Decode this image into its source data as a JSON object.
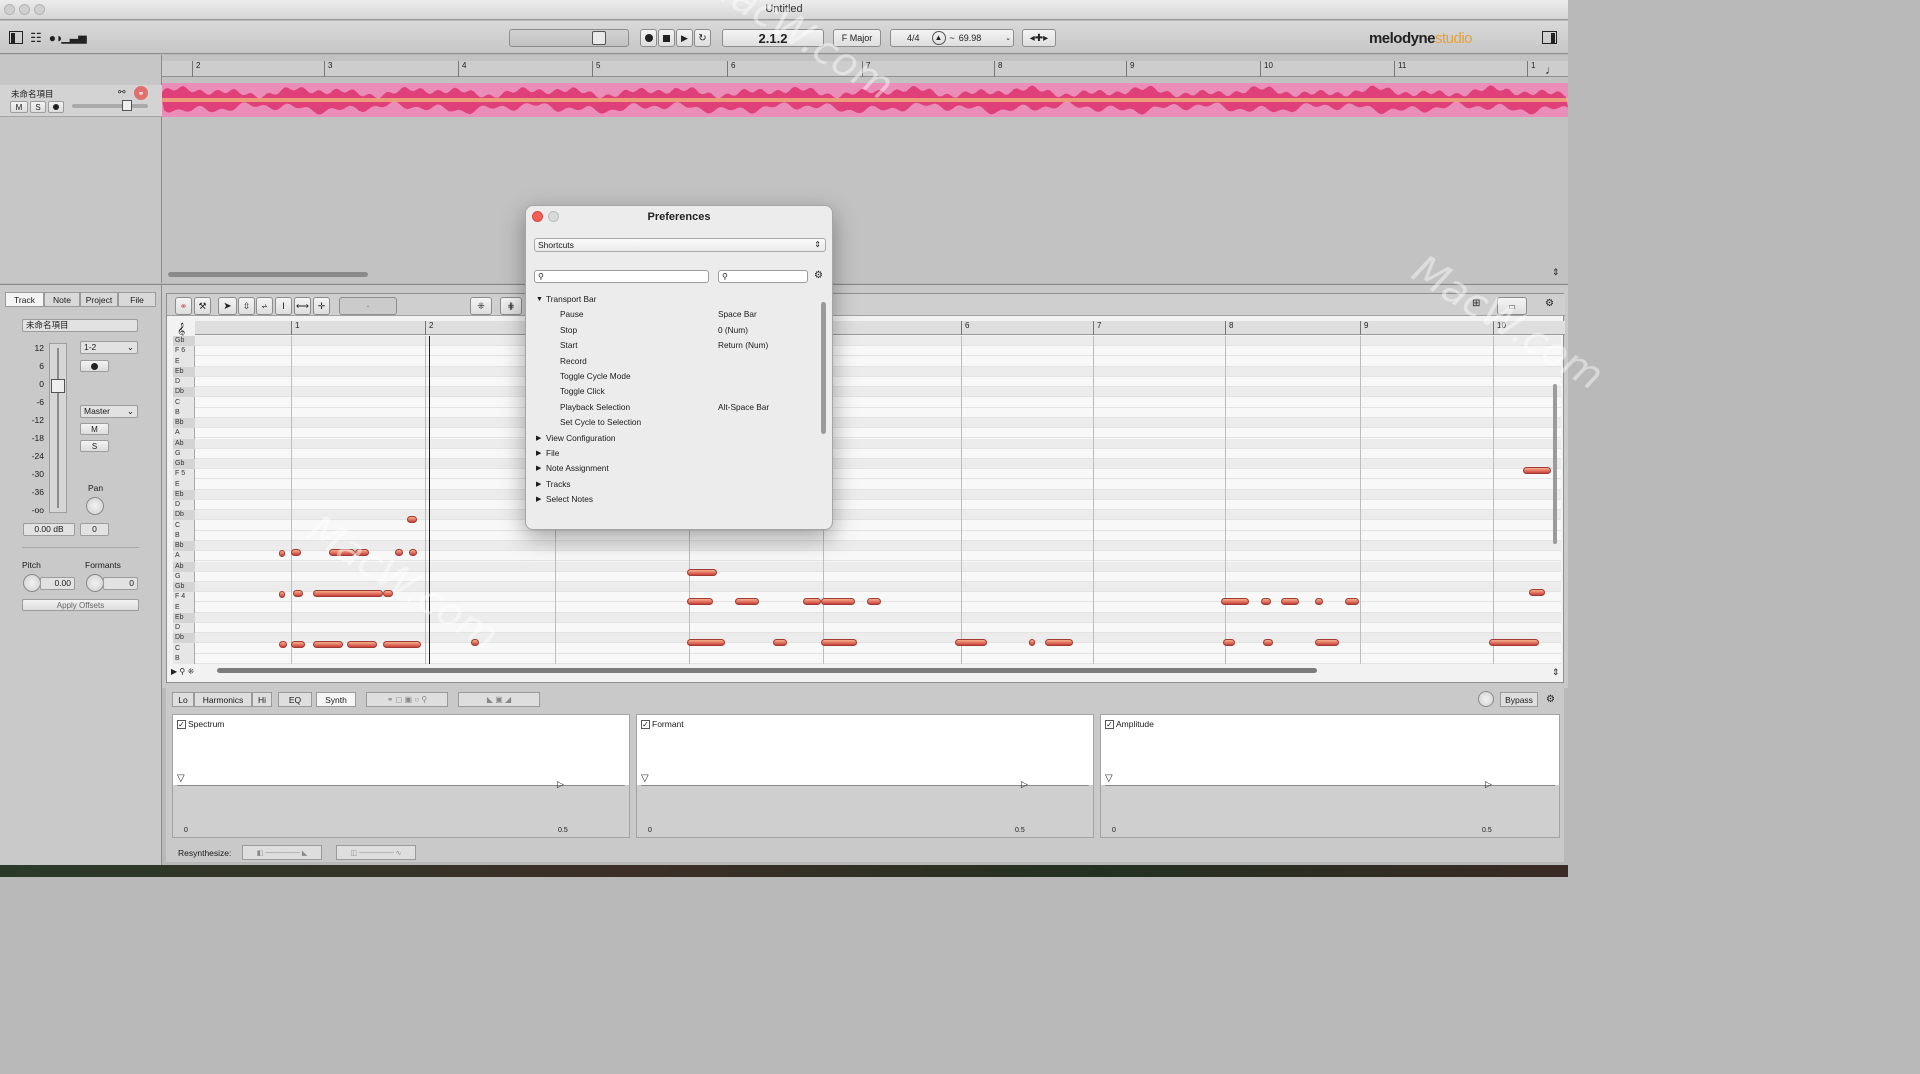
{
  "window": {
    "title": "Untitled"
  },
  "toolbar": {
    "position": "2.1.2",
    "key": "F Major",
    "time_sig": "4/4",
    "tempo_prefix": "~",
    "tempo": "69.98",
    "brand_main": "melodyne",
    "brand_sub": "studio"
  },
  "arrange": {
    "track_name": "未命名項目",
    "mute": "M",
    "solo": "S",
    "bars": [
      "2",
      "3",
      "4",
      "5",
      "6",
      "7",
      "8",
      "9",
      "10",
      "11",
      "1"
    ]
  },
  "inspector": {
    "tabs": [
      "Track",
      "Note",
      "Project",
      "File"
    ],
    "track_name": "未命名項目",
    "db_scale": [
      "12",
      "6",
      "0",
      "-6",
      "-12",
      "-18",
      "-24",
      "-30",
      "-36",
      "-oo"
    ],
    "input": "1-2",
    "output": "Master",
    "mute": "M",
    "solo": "S",
    "pan_label": "Pan",
    "volume": "0.00 dB",
    "pan_value": "0",
    "pitch_label": "Pitch",
    "pitch_value": "0.00",
    "formants_label": "Formants",
    "formants_value": "0",
    "apply_offsets": "Apply Offsets"
  },
  "editor": {
    "ruler": [
      "1",
      "2",
      "6",
      "7",
      "8",
      "9",
      "10"
    ],
    "selection_field": "-",
    "keys": [
      "Gb",
      "F 6",
      "E",
      "Eb",
      "D",
      "Db",
      "C",
      "B",
      "Bb",
      "A",
      "Ab",
      "G",
      "Gb",
      "F 5",
      "E",
      "Eb",
      "D",
      "Db",
      "C",
      "B",
      "Bb",
      "A",
      "Ab",
      "G",
      "Gb",
      "F 4",
      "E",
      "Eb",
      "D",
      "Db",
      "C",
      "B"
    ]
  },
  "dock": {
    "tabs": [
      "Lo",
      "Harmonics",
      "Hi",
      "EQ",
      "Synth"
    ],
    "bypass": "Bypass",
    "panels": [
      {
        "title": "Spectrum",
        "tick_left": "0",
        "tick_right": "0.5"
      },
      {
        "title": "Formant",
        "tick_left": "0",
        "tick_right": "0.5"
      },
      {
        "title": "Amplitude",
        "tick_left": "0",
        "tick_right": "0.5"
      }
    ],
    "resynthesize_label": "Resynthesize:"
  },
  "preferences": {
    "title": "Preferences",
    "category": "Shortcuts",
    "groups": [
      {
        "label": "Transport Bar",
        "expanded": true,
        "items": [
          {
            "action": "Pause",
            "key": "Space Bar"
          },
          {
            "action": "Stop",
            "key": "0 (Num)"
          },
          {
            "action": "Start",
            "key": "Return (Num)"
          },
          {
            "action": "Record",
            "key": ""
          },
          {
            "action": "Toggle Cycle Mode",
            "key": ""
          },
          {
            "action": "Toggle Click",
            "key": ""
          },
          {
            "action": "Playback Selection",
            "key": "Alt-Space Bar"
          },
          {
            "action": "Set Cycle to Selection",
            "key": ""
          }
        ]
      },
      {
        "label": "View Configuration",
        "expanded": false
      },
      {
        "label": "File",
        "expanded": false
      },
      {
        "label": "Note Assignment",
        "expanded": false
      },
      {
        "label": "Tracks",
        "expanded": false
      },
      {
        "label": "Select Notes",
        "expanded": false
      }
    ]
  },
  "watermark": "MacW.com",
  "colors": {
    "waveform": "#e0407a",
    "note": "#e16b5b",
    "close": "#f25f56",
    "brand_accent": "#e3a13b"
  }
}
